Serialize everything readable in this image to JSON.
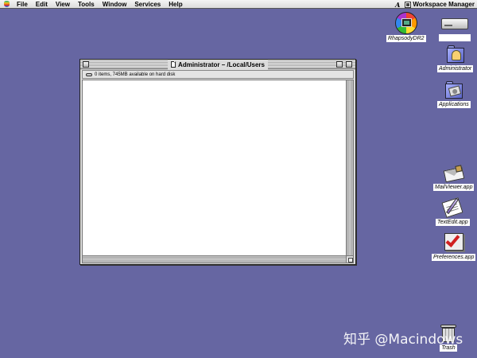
{
  "menubar": {
    "apple_label": "",
    "items": [
      "File",
      "Edit",
      "View",
      "Tools",
      "Window",
      "Services",
      "Help"
    ],
    "right_glyph": "A",
    "active_app": "Workspace Manager"
  },
  "desktop_icons": {
    "rhapsody": "RhapsodyDR2",
    "disk": "",
    "administrator": "Administrator",
    "applications": "Applications",
    "mailviewer": "MailViewer.app",
    "textedit": "TextEdit.app",
    "preferences": "Preferences.app",
    "trash": "Trash"
  },
  "window": {
    "title": "Administrator  –  /Local/Users",
    "status": "0 items, 745MB available on hard disk"
  },
  "watermark": "知乎 @Macindows",
  "colors": {
    "desktop": "#6666a2",
    "window_bg": "#dcdcdc",
    "content_bg": "#ffffff"
  }
}
